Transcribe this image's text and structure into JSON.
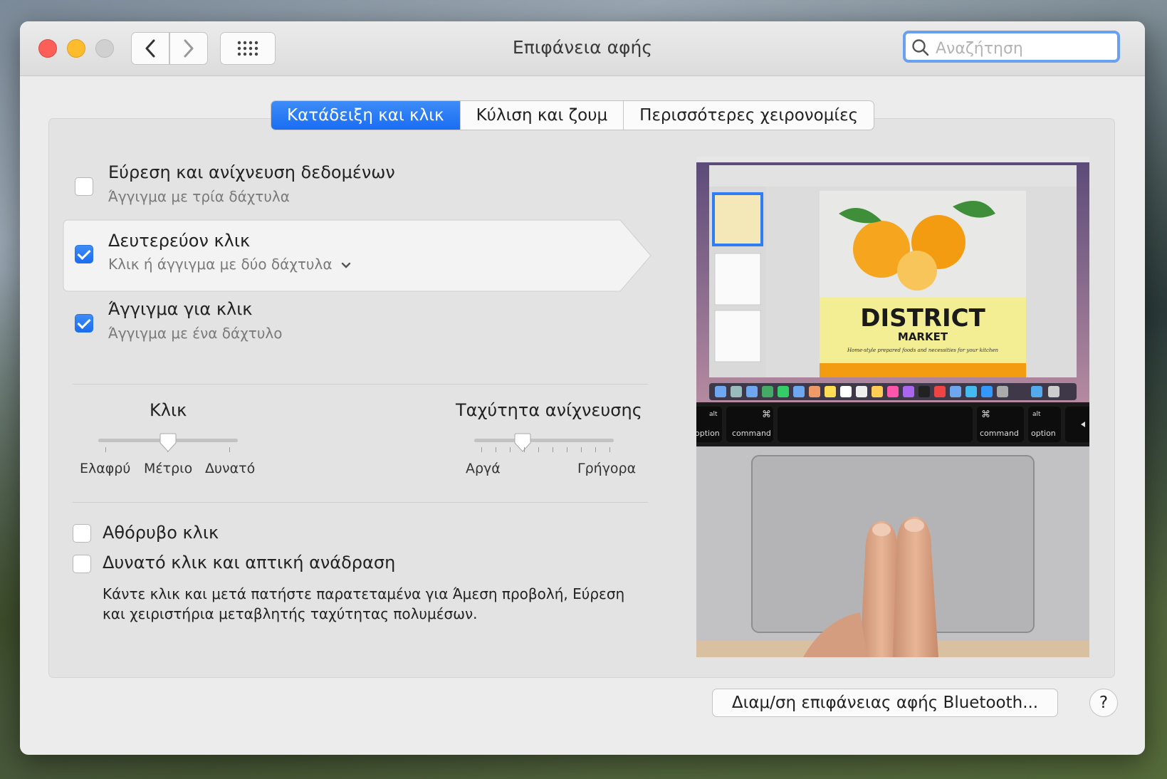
{
  "window": {
    "title": "Επιφάνεια αφής",
    "search_placeholder": "Αναζήτηση"
  },
  "tabs": [
    {
      "label": "Κατάδειξη και κλικ",
      "active": true
    },
    {
      "label": "Κύλιση και ζουμ",
      "active": false
    },
    {
      "label": "Περισσότερες χειρονομίες",
      "active": false
    }
  ],
  "options": [
    {
      "title": "Εύρεση και ανίχνευση δεδομένων",
      "subtitle": "Άγγιγμα με τρία δάχτυλα",
      "checked": false
    },
    {
      "title": "Δευτερεύον κλικ",
      "subtitle": "Κλικ ή άγγιγμα με δύο δάχτυλα",
      "checked": true
    },
    {
      "title": "Άγγιγμα για κλικ",
      "subtitle": "Άγγιγμα με ένα δάχτυλο",
      "checked": true
    }
  ],
  "sliders": {
    "click": {
      "title": "Κλικ",
      "labels": [
        "Ελαφρύ",
        "Μέτριο",
        "Δυνατό"
      ],
      "value_index": 1
    },
    "speed": {
      "title": "Ταχύτητα ανίχνευσης",
      "min_label": "Αργά",
      "max_label": "Γρήγορα",
      "value_index": 3
    }
  },
  "bottom_options": [
    {
      "title": "Αθόρυβο κλικ",
      "checked": false
    },
    {
      "title": "Δυνατό κλικ και απτική ανάδραση",
      "checked": false
    }
  ],
  "note": "Κάντε κλικ και μετά πατήστε παρατεταμένα για Άμεση προβολή, Εύρεση και χειριστήρια μεταβλητής ταχύτητας πολυμέσων.",
  "preview": {
    "poster_title": "DISTRICT",
    "poster_subtitle": "MARKET",
    "poster_tagline": "Home-style prepared foods and necessities for your kitchen",
    "keys": {
      "alt": "alt",
      "option": "option",
      "command": "command",
      "cmd_symbol": "⌘"
    }
  },
  "footer": {
    "bluetooth_button": "Διαμ/ση επιφάνειας αφής Bluetooth...",
    "help": "?"
  }
}
